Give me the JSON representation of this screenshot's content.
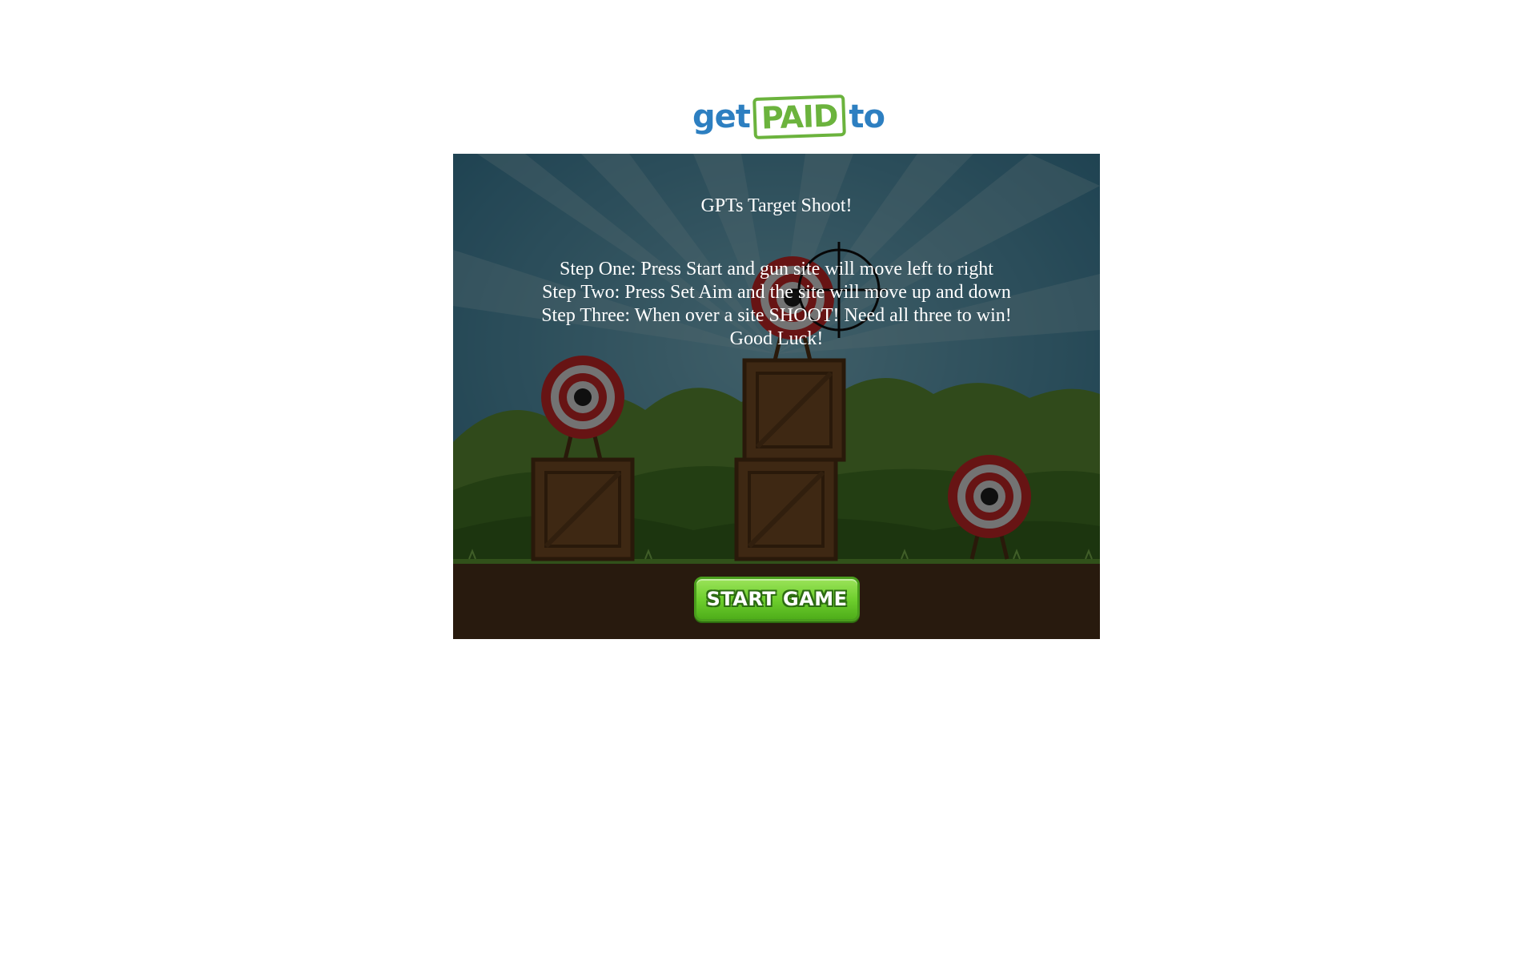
{
  "logo": {
    "part1": "get",
    "part2": "PAID",
    "part3": "to",
    "colors": {
      "blue": "#2d7fc1",
      "green": "#6bb33d"
    }
  },
  "game": {
    "title": "GPTs Target Shoot!",
    "instructions": [
      "Step One: Press Start and gun site will move left to right",
      "Step Two: Press Set Aim and the site will move up and down",
      "Step Three: When over a site SHOOT! Need all three to win!",
      "Good Luck!"
    ],
    "start_button": "START GAME",
    "scene_icons": [
      "target-icon",
      "crate-icon",
      "crosshair-icon"
    ]
  }
}
